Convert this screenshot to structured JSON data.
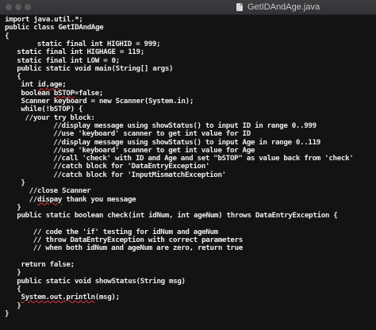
{
  "window": {
    "title": "GetIDAndAge.java",
    "accent_colors": {
      "background": "#141313",
      "text": "#ececec",
      "error_underline": "#e0383e"
    }
  },
  "editor": {
    "lines": [
      {
        "indent": 0,
        "text": "import java.util.*;"
      },
      {
        "indent": 0,
        "text": "public class GetIDAndAge"
      },
      {
        "indent": 0,
        "text": "{"
      },
      {
        "indent": 8,
        "text": "static final int HIGHID = 999;"
      },
      {
        "indent": 3,
        "text": "static final int HIGHAGE = 119;"
      },
      {
        "indent": 3,
        "text": "static final int LOW = 0;"
      },
      {
        "indent": 3,
        "text": "public static void main(String[] args)"
      },
      {
        "indent": 3,
        "text": "{"
      },
      {
        "indent": 4,
        "text": "int id,age;"
      },
      {
        "indent": 4,
        "text": "boolean bSTOP=false;"
      },
      {
        "indent": 4,
        "text": "Scanner keyboard = new Scanner(System.in);"
      },
      {
        "indent": 4,
        "text": "while(!bSTOP) {"
      },
      {
        "indent": 5,
        "text": "//your try block:"
      },
      {
        "indent": 12,
        "text": "//display message using showStatus() to input ID in range 0..999"
      },
      {
        "indent": 12,
        "text": "//use 'keyboard' scanner to get int value for ID"
      },
      {
        "indent": 12,
        "text": "//display message using showStatus() to input Age in range 0..119"
      },
      {
        "indent": 12,
        "text": "//use 'keyboard' scanner to get int value for Age"
      },
      {
        "indent": 12,
        "text": "//call 'check' with ID and Age and set \"bSTOP\" as value back from 'check'"
      },
      {
        "indent": 12,
        "text": "//catch block for 'DataEntryException'"
      },
      {
        "indent": 12,
        "text": "//catch block for 'InputMismatchException'"
      },
      {
        "indent": 4,
        "text": "}"
      },
      {
        "indent": 6,
        "text": "//close Scanner"
      },
      {
        "indent": 6,
        "text": "//dispay thank you message"
      },
      {
        "indent": 3,
        "text": "}"
      },
      {
        "indent": 3,
        "text": "public static boolean check(int idNum, int ageNum) throws DataEntryException {"
      },
      {
        "indent": 0,
        "text": ""
      },
      {
        "indent": 7,
        "text": "// code the 'if' testing for idNum and ageNum"
      },
      {
        "indent": 7,
        "text": "// throw DataEntryException with correct parameters"
      },
      {
        "indent": 7,
        "text": "// when both idNum and ageNum are zero, return true"
      },
      {
        "indent": 0,
        "text": ""
      },
      {
        "indent": 4,
        "text": "return false;"
      },
      {
        "indent": 3,
        "text": "}"
      },
      {
        "indent": 3,
        "text": "public static void showStatus(String msg)"
      },
      {
        "indent": 3,
        "text": "{"
      },
      {
        "indent": 4,
        "text": "System.out.println(msg);"
      },
      {
        "indent": 3,
        "text": "}"
      },
      {
        "indent": 0,
        "text": "}"
      }
    ]
  }
}
